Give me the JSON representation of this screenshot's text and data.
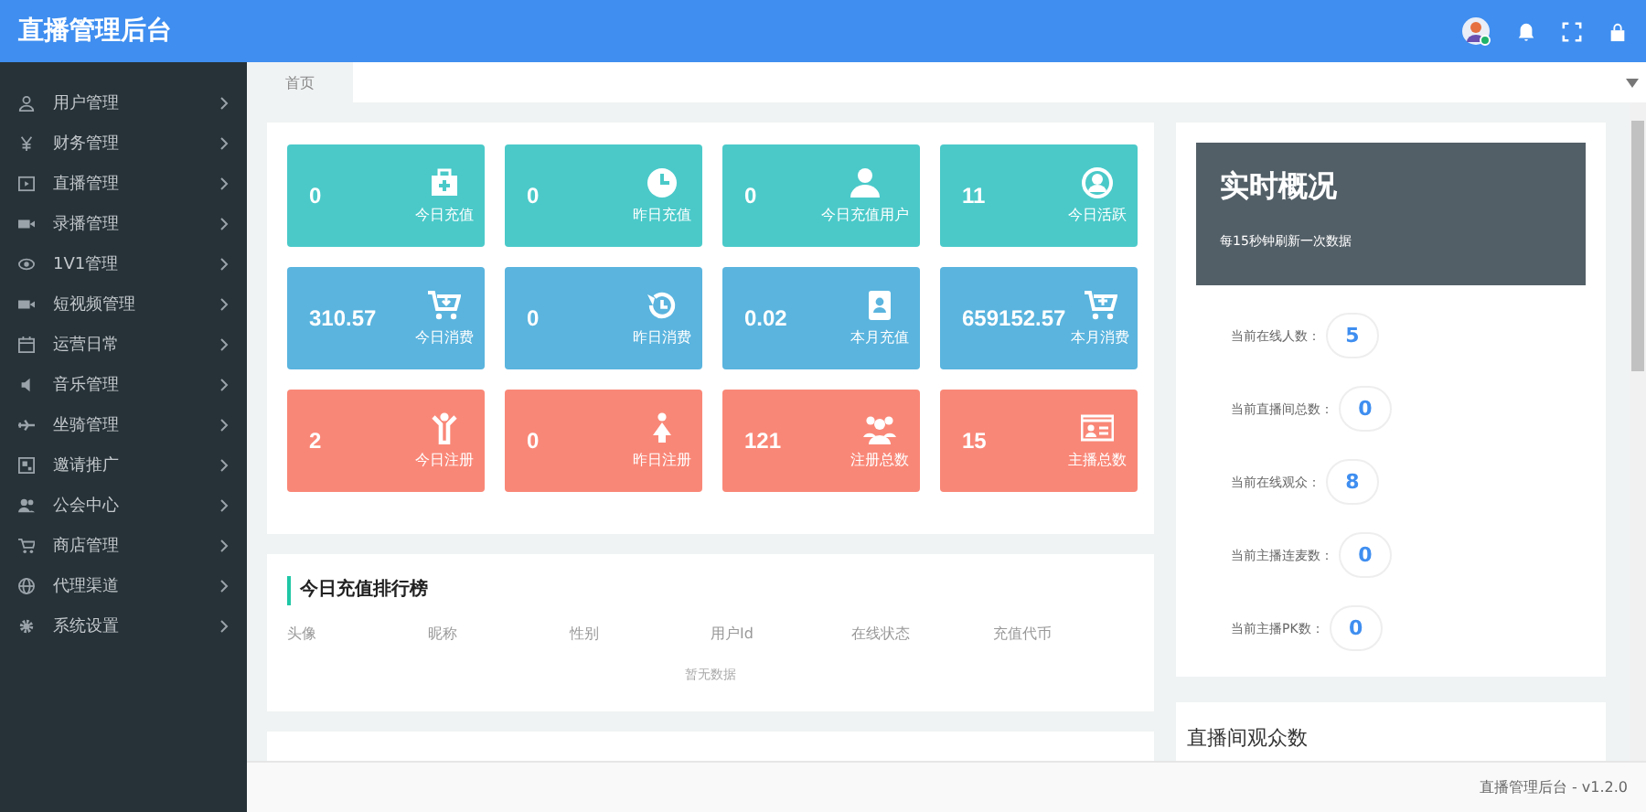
{
  "header": {
    "title": "直播管理后台"
  },
  "sidebar": {
    "items": [
      {
        "label": "用户管理",
        "expanded": false
      },
      {
        "label": "财务管理",
        "expanded": false
      },
      {
        "label": "直播管理",
        "expanded": false
      },
      {
        "label": "录播管理",
        "expanded": false
      },
      {
        "label": "1V1管理",
        "expanded": false
      },
      {
        "label": "短视频管理",
        "expanded": false
      },
      {
        "label": "运营日常",
        "expanded": false
      },
      {
        "label": "音乐管理",
        "expanded": false
      },
      {
        "label": "坐骑管理",
        "expanded": false
      },
      {
        "label": "邀请推广",
        "expanded": false
      },
      {
        "label": "公会中心",
        "expanded": false
      },
      {
        "label": "商店管理",
        "expanded": false
      },
      {
        "label": "代理渠道",
        "expanded": false
      },
      {
        "label": "系统设置",
        "expanded": false
      }
    ]
  },
  "tabs": [
    {
      "label": "首页",
      "selected": true
    }
  ],
  "stats": [
    {
      "value": "0",
      "label": "今日充值",
      "color": "#4bc9c9"
    },
    {
      "value": "0",
      "label": "昨日充值",
      "color": "#4bc9c9"
    },
    {
      "value": "0",
      "label": "今日充值用户",
      "color": "#4bc9c9"
    },
    {
      "value": "11",
      "label": "今日活跃",
      "color": "#4bc9c9"
    },
    {
      "value": "310.57",
      "label": "今日消费",
      "color": "#5ab4de"
    },
    {
      "value": "0",
      "label": "昨日消费",
      "color": "#5ab4de"
    },
    {
      "value": "0.02",
      "label": "本月充值",
      "color": "#5ab4de"
    },
    {
      "value": "659152.57",
      "label": "本月消费",
      "color": "#5ab4de"
    },
    {
      "value": "2",
      "label": "今日注册",
      "color": "#f98777"
    },
    {
      "value": "0",
      "label": "昨日注册",
      "color": "#f98777"
    },
    {
      "value": "121",
      "label": "注册总数",
      "color": "#f98777"
    },
    {
      "value": "15",
      "label": "主播总数",
      "color": "#f98777"
    }
  ],
  "ranking": {
    "title": "今日充值排行榜",
    "columns": [
      "头像",
      "昵称",
      "性别",
      "用户Id",
      "在线状态",
      "充值代币"
    ],
    "empty": "暂无数据"
  },
  "realtime": {
    "title": "实时概况",
    "subtitle": "每15秒钟刷新一次数据",
    "rows": [
      {
        "label": "当前在线人数：",
        "value": "5"
      },
      {
        "label": "当前直播间总数：",
        "value": "0"
      },
      {
        "label": "当前在线观众：",
        "value": "8"
      },
      {
        "label": "当前主播连麦数：",
        "value": "0"
      },
      {
        "label": "当前主播PK数：",
        "value": "0"
      }
    ]
  },
  "audience": {
    "title": "直播间观众数"
  },
  "footer": {
    "text": "直播管理后台 - v1.2.0"
  }
}
